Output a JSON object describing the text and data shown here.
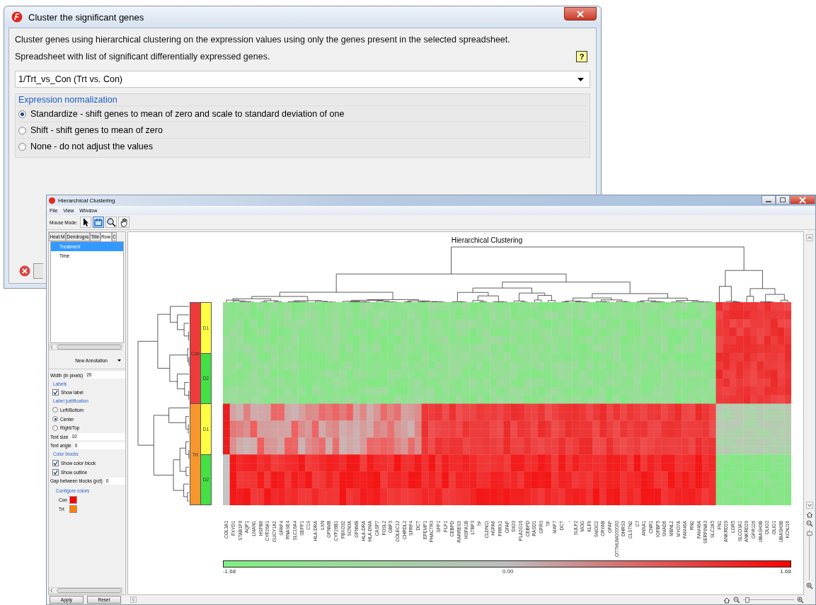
{
  "dialog": {
    "title": "Cluster the significant genes",
    "description": "Cluster genes using hierarchical clustering on the expression values using only the genes present in the selected spreadsheet.",
    "spreadsheet_label": "Spreadsheet with list of significant differentially expressed genes.",
    "help": "?",
    "spreadsheet_value": "1/Trt_vs_Con (Trt vs. Con)",
    "normalization": {
      "title": "Expression normalization",
      "options": [
        {
          "label": "Standardize - shift genes to mean of zero and scale to standard deviation of one",
          "selected": true
        },
        {
          "label": "Shift - shift genes to mean of zero",
          "selected": false
        },
        {
          "label": "None - do not adjust the values",
          "selected": false
        }
      ]
    }
  },
  "window": {
    "title": "Hierarchical Clustering",
    "menu": [
      "File",
      "View",
      "Window"
    ],
    "mouse_mode": {
      "label": "Mouse Mode:",
      "tools": [
        {
          "kind": "pointer",
          "selected": false
        },
        {
          "kind": "select",
          "selected": true
        },
        {
          "kind": "zoom",
          "selected": false
        },
        {
          "kind": "pan",
          "selected": false
        }
      ]
    }
  },
  "panel": {
    "tabs": [
      {
        "label": "Heat M",
        "selected": false
      },
      {
        "label": "Dendrogra",
        "selected": false
      },
      {
        "label": "Title",
        "selected": false
      },
      {
        "label": "Row",
        "selected": true
      },
      {
        "label": "C",
        "selected": false
      }
    ],
    "annotations": [
      {
        "label": "Treatment",
        "selected": true
      },
      {
        "label": "Time",
        "selected": false
      }
    ],
    "new_annotation": "New Annotation",
    "width_label": "Width (in pixels)",
    "width_value": "20",
    "labels_header": "Labels",
    "show_label": {
      "label": "Show label",
      "checked": true
    },
    "justification_header": "Label justification",
    "justification": [
      {
        "label": "Left/Bottom",
        "selected": false
      },
      {
        "label": "Center",
        "selected": true
      },
      {
        "label": "Right/Top",
        "selected": false
      }
    ],
    "text_size_label": "Text size",
    "text_size_value": "10",
    "text_angle_label": "Text angle",
    "text_angle_value": "0",
    "color_blocks_header": "Color blocks",
    "show_color_block": {
      "label": "Show color block",
      "checked": true
    },
    "show_outline": {
      "label": "Show outline",
      "checked": true
    },
    "gap_label": "Gap between blocks (pct)",
    "gap_value": "0",
    "configure_colors": "Configure colors",
    "colors": [
      {
        "label": "Con",
        "color": "#ff0000"
      },
      {
        "label": "Trt",
        "color": "#ff8000"
      }
    ],
    "buttons": [
      "Apply",
      "Reset"
    ]
  },
  "plot": {
    "title": "Hierarchical Clustering",
    "treatment": [
      {
        "label": "Con",
        "color": "#ee3a3a"
      },
      {
        "label": "Trt",
        "color": "#f7962e"
      }
    ],
    "time": [
      {
        "label": "D1",
        "color": "#ffff44"
      },
      {
        "label": "D2",
        "color": "#44e044"
      },
      {
        "label": "D1",
        "color": "#ffff44"
      },
      {
        "label": "D2",
        "color": "#44e044"
      }
    ],
    "genes": [
      "COL3A1",
      "FXYD1",
      "STAB1P8",
      "AQP1",
      "LMAN1",
      "HSPB8",
      "CYP26A1",
      "GUCY1A2",
      "SFRP4",
      "RNASE4",
      "SLC16A4",
      "SEPP1",
      "C1S",
      "HLA-DRA",
      "LXN",
      "GPNMB",
      "CYP26B1",
      "FBXO32",
      "SCN3A",
      "GPNMB",
      "HLA-DRA",
      "HLA-DMA",
      "CASP7",
      "FOSL2",
      "GBP3",
      "COLEC12",
      "CHRDL2",
      "SFRP4",
      "DCT",
      "EFEMP1",
      "PHACTR3",
      "SPP1",
      "PLP1",
      "CEBPD",
      "RARRES3",
      "HSPA1B",
      "LTBP3",
      "TF",
      "CLDN11",
      "HSPA6",
      "PRRX1",
      "GFAP",
      "DIO3",
      "PLA2G16",
      "CEBPD",
      "RASD1",
      "GPR3",
      "TF",
      "MAP7",
      "DCT",
      "-",
      "SULF2",
      "MOG",
      "KLF9",
      "SMOC2",
      "CRYAB",
      "GFAP",
      "OTTHUMG00000",
      "DHRS3",
      "CLSTN2",
      "C7",
      "ANXA1",
      "CNR1",
      "IGFBP5",
      "SMAD6",
      "MBNL2",
      "MYO7A",
      "FAM46A",
      "RN2",
      "FAM46A",
      "SERPINA3",
      "SLC2A5",
      "FN1",
      "ANKRD29",
      "LGR5",
      "SLCO3A1",
      "ANKRD29",
      "GPR126",
      "UBASH3B",
      "OLIG2",
      "OLIG1",
      "UBASH3B",
      "KCNJ16"
    ],
    "legend": {
      "min": "-1.68",
      "mid": "0.00",
      "max": "1.68"
    },
    "vertical_zoom": {
      "level": 0.95
    },
    "horizontal_zoom": {
      "level": 0.05
    }
  }
}
